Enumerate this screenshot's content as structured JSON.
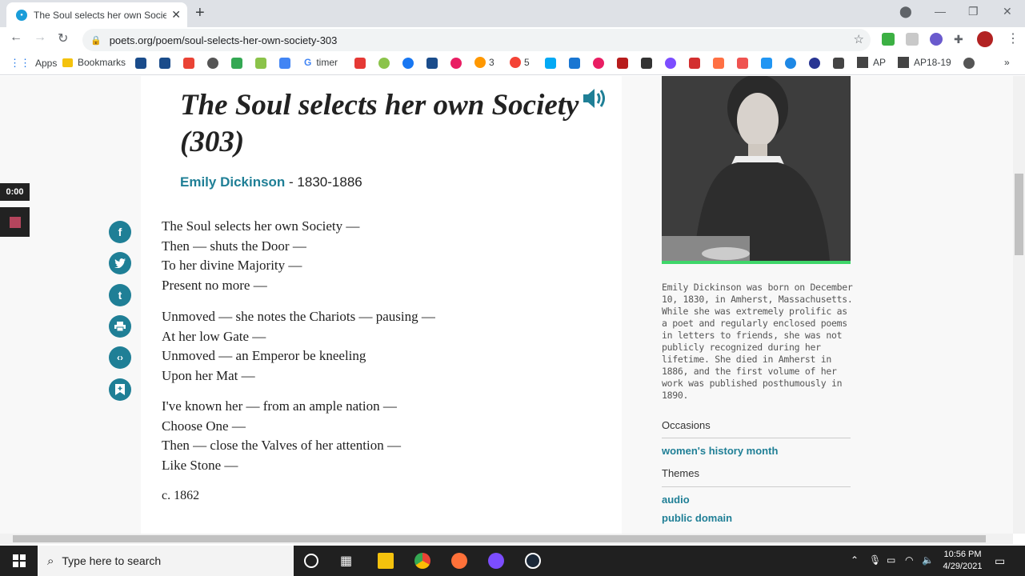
{
  "browser": {
    "tab_title": "The Soul selects her own Society",
    "url": "poets.org/poem/soul-selects-her-own-society-303"
  },
  "bookmarks": {
    "apps": "Apps",
    "bookmarks": "Bookmarks",
    "timer": "timer",
    "num3": "3",
    "num5": "5",
    "ap": "AP",
    "ap1819": "AP18-19"
  },
  "recorder": {
    "time": "0:00"
  },
  "poem": {
    "title": "The Soul selects her own Society (303)",
    "author": "Emily Dickinson",
    "years": " - 1830-1886",
    "stanzas": [
      [
        "The Soul selects her own Society —",
        "Then — shuts the Door —",
        "To her divine Majority —",
        "Present no more —"
      ],
      [
        "Unmoved — she notes the Chariots — pausing —",
        "At her low Gate —",
        "Unmoved — an Emperor be kneeling",
        "Upon her Mat —"
      ],
      [
        "I've known her — from an ample nation —",
        "Choose One —",
        "Then — close the Valves of her attention —",
        "Like Stone —"
      ]
    ],
    "date": "c. 1862"
  },
  "share": {
    "facebook": "f",
    "twitter": "t-bird",
    "tumblr": "t"
  },
  "sidebar": {
    "bio": "Emily Dickinson was born on December 10, 1830, in Amherst, Massachusetts. While she was extremely prolific as a poet and regularly enclosed poems in letters to friends, she was not publicly recognized during her lifetime. She died in Amherst in 1886, and the first volume of her work was published posthumously in 1890.",
    "occasions_heading": "Occasions",
    "occasions": [
      "women's history month"
    ],
    "themes_heading": "Themes",
    "themes": [
      "audio",
      "public domain"
    ]
  },
  "taskbar": {
    "search_placeholder": "Type here to search",
    "time": "10:56 PM",
    "date": "4/29/2021"
  },
  "colors": {
    "brand_teal": "#1f7f96",
    "accent_green": "#3fd66a"
  }
}
